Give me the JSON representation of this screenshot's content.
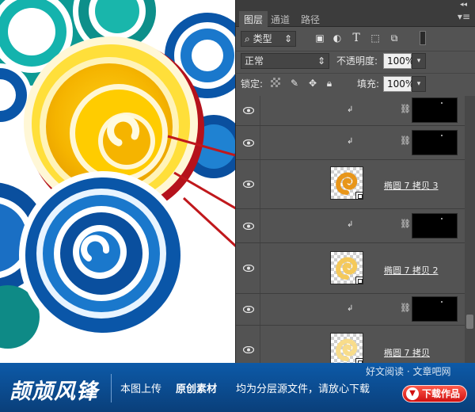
{
  "panel": {
    "tabs": [
      {
        "label": "图层",
        "active": true
      },
      {
        "label": "通道",
        "active": false
      },
      {
        "label": "路径",
        "active": false
      }
    ],
    "filter": {
      "kind_label": "类型",
      "icons": [
        "image-filter-icon",
        "adjustment-filter-icon",
        "type-filter-icon",
        "shape-filter-icon",
        "smart-object-filter-icon",
        "filter-toggle-icon"
      ]
    },
    "blend_mode": "正常",
    "opacity_label": "不透明度:",
    "opacity_value": "100%",
    "lock_label": "锁定:",
    "fill_label": "填充:",
    "fill_value": "100%",
    "layers": [
      {
        "type": "clip",
        "name": ""
      },
      {
        "type": "clip",
        "name": ""
      },
      {
        "type": "shape",
        "name": "椭圆 7 拷贝 3",
        "color": "#e8961a"
      },
      {
        "type": "clip",
        "name": ""
      },
      {
        "type": "shape",
        "name": "椭圆 7 拷贝 2",
        "color": "#f5c95a"
      },
      {
        "type": "clip",
        "name": ""
      },
      {
        "type": "shape",
        "name": "椭圆 7 拷贝",
        "color": "#f8dc8a"
      }
    ]
  },
  "banner": {
    "brand": "颉颃风锋",
    "t1": "本图上传",
    "t2": "原创素材",
    "t3": "均为分层源文件，请放心下载",
    "download": "下载作品",
    "watermark": "好文阅读 · 文章吧网"
  },
  "colors": {
    "panel_bg": "#535353",
    "annotation_line": "#c0181c",
    "banner_blue": "#0d5aa8",
    "cloud_yellow": "#f6c51c",
    "cloud_blue": "#0a56a8"
  }
}
